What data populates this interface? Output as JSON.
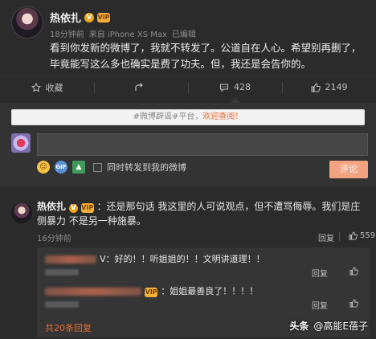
{
  "post": {
    "author": "热依扎",
    "v_badge": "V",
    "vip_badge": "VIP",
    "time": "18分钟前",
    "source": "来自 iPhone XS Max",
    "edit_label": "已编辑",
    "text": "看到你发新的微博了，我就不转发了。公道自在人心。希望别再删了，毕竟能写这么多也确实是费了功夫。但，我还是会告你的。"
  },
  "actions": [
    {
      "label": "收藏",
      "icon": "star-icon"
    },
    {
      "label": "",
      "icon": "share-icon"
    },
    {
      "label": "428",
      "icon": "comment-icon"
    },
    {
      "label": "2149",
      "icon": "thumbs-up-icon"
    }
  ],
  "comment_box": {
    "notice_tag": "#微博辟谣#平台，",
    "notice_link": "欢迎查阅！",
    "input_value": "",
    "forward_label": "同时转发到我的微博",
    "submit_label": "评论",
    "tools": [
      "emoji-icon",
      "gif-icon",
      "image-icon"
    ]
  },
  "reply": {
    "author": "热依扎",
    "text": "：还是那句话 我这里的人可说观点，但不遭骂侮辱。我们是庄侧暴力 不是另一种施暴。",
    "time": "16分钟前",
    "reply_label": "回复",
    "likes": "559"
  },
  "sub_replies": [
    {
      "text": "V：好的！！听姐姐的！！文明讲道理！！",
      "reply_label": "回复",
      "like_icon": "thumbs-up-icon"
    },
    {
      "text": "：姐姐最善良了！！！！",
      "reply_label": "回复",
      "like_icon": "thumbs-up-icon"
    }
  ],
  "more_replies": "共20条回复",
  "watermark": {
    "logo": "头条",
    "handle": "@高能E蓓子"
  }
}
